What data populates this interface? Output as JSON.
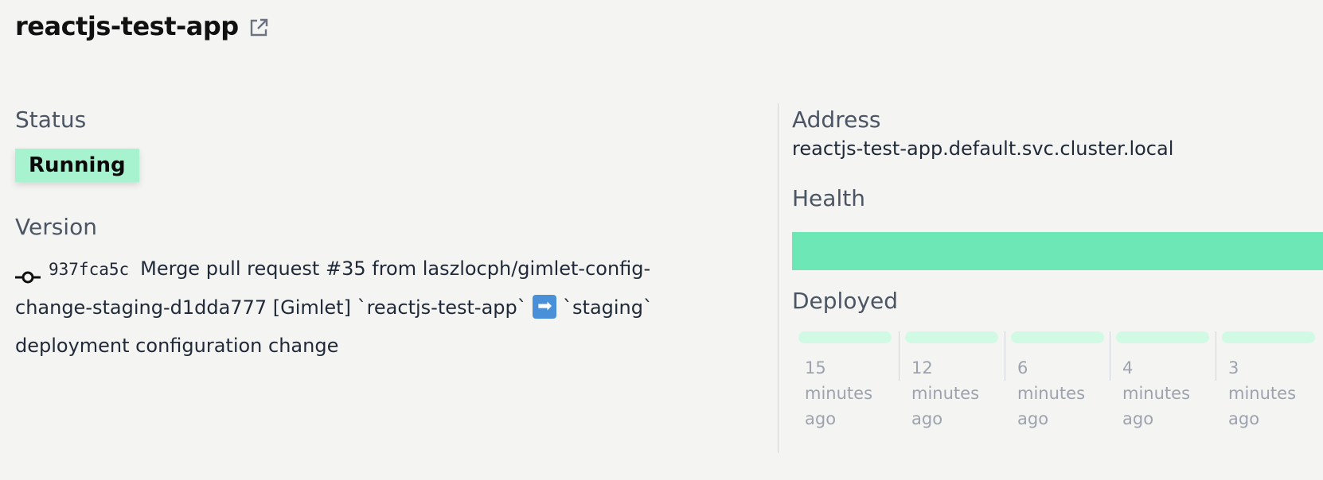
{
  "app": {
    "title": "reactjs-test-app",
    "external_link_icon": "external-link-icon"
  },
  "status": {
    "label": "Status",
    "value": "Running",
    "badge_color": "#a7f3d0"
  },
  "version": {
    "label": "Version",
    "commit_icon": "git-commit-icon",
    "sha": "937fca5c",
    "message_part1": "Merge pull request #35 from laszlocph/gimlet-config-change-staging-d1dda777 [Gimlet] `reactjs-test-app`",
    "arrow_emoji": "➡",
    "message_part2": "`staging` deployment configuration change"
  },
  "address": {
    "label": "Address",
    "value": "reactjs-test-app.default.svc.cluster.local"
  },
  "health": {
    "label": "Health",
    "level": 1.0,
    "bar_color": "#6ee7b7"
  },
  "deployed": {
    "label": "Deployed",
    "items": [
      {
        "number": "15",
        "unit": "minutes",
        "suffix": "ago"
      },
      {
        "number": "12",
        "unit": "minutes",
        "suffix": "ago"
      },
      {
        "number": "6",
        "unit": "minutes",
        "suffix": "ago"
      },
      {
        "number": "4",
        "unit": "minutes",
        "suffix": "ago"
      },
      {
        "number": "3",
        "unit": "minutes",
        "suffix": "ago"
      }
    ]
  }
}
